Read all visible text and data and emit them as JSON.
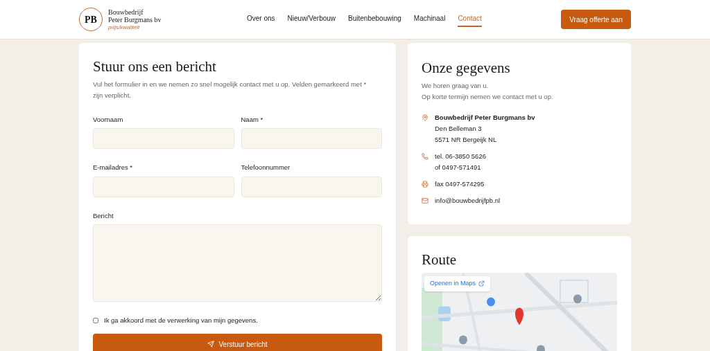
{
  "brand": {
    "initials": "PB",
    "name_line1": "Bouwbedrijf",
    "name_line2": "Peter Burgmans bv",
    "tagline": "prijs/kwaliteit"
  },
  "nav": [
    {
      "label": "Over ons",
      "selected": false
    },
    {
      "label": "Nieuw/Verbouw",
      "selected": false
    },
    {
      "label": "Buitenbebouwing",
      "selected": false
    },
    {
      "label": "Machinaal",
      "selected": false
    },
    {
      "label": "Contact",
      "selected": true
    }
  ],
  "cta": "Vraag offerte aan",
  "form": {
    "title": "Stuur ons een bericht",
    "intro": "Vul het formulier in en we nemen zo snel mogelijk contact met u op. Velden gemarkeerd met * zijn verplicht.",
    "fields": [
      {
        "label": "Voornaam",
        "kind": "input"
      },
      {
        "label": "Naam *",
        "kind": "input"
      },
      {
        "label": "E-mailadres *",
        "kind": "input"
      },
      {
        "label": "Telefoonnummer",
        "kind": "input"
      },
      {
        "label": "Bericht",
        "kind": "textarea"
      }
    ],
    "consent": {
      "label": "Ik ga akkoord met de verwerking van mijn gegevens.",
      "checked": false
    },
    "submit": "Verstuur bericht"
  },
  "details": {
    "title": "Onze gegevens",
    "intro": [
      "We horen graag van u.",
      "Op korte termijn nemen we contact met u op."
    ],
    "items": [
      {
        "kind": "location",
        "title": "Bouwbedrijf Peter Burgmans bv",
        "lines": [
          "Den Belleman 3",
          "5571 NR Bergeijk NL"
        ]
      },
      {
        "kind": "phone",
        "lines": [
          "tel. 06-3850 5626",
          "of 0497-571491"
        ]
      },
      {
        "kind": "fax",
        "lines": [
          "fax 0497-574295"
        ]
      },
      {
        "kind": "mail",
        "lines": [
          "info@bouwbedrijfpb.nl"
        ]
      }
    ]
  },
  "route": {
    "title": "Route",
    "map_link": "Openen in Maps"
  }
}
